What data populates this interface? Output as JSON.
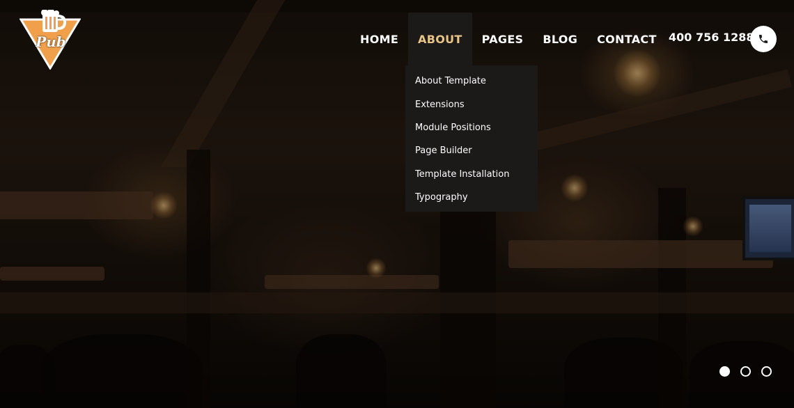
{
  "brand": {
    "logo_text": "Pub",
    "logo_color": "#f0a04b"
  },
  "nav": {
    "items": [
      {
        "label": "HOME",
        "active": false
      },
      {
        "label": "ABOUT",
        "active": true
      },
      {
        "label": "PAGES",
        "active": false
      },
      {
        "label": "BLOG",
        "active": false
      },
      {
        "label": "CONTACT",
        "active": false
      }
    ],
    "active_color": "#e8c487"
  },
  "phone": {
    "number": "400 756 1288",
    "icon": "phone-icon"
  },
  "dropdown": {
    "items": [
      {
        "label": "About Template"
      },
      {
        "label": "Extensions"
      },
      {
        "label": "Module Positions"
      },
      {
        "label": "Page Builder"
      },
      {
        "label": "Template Installation"
      },
      {
        "label": "Typography"
      }
    ]
  },
  "slider": {
    "total_slides": 3,
    "active_index": 1
  }
}
